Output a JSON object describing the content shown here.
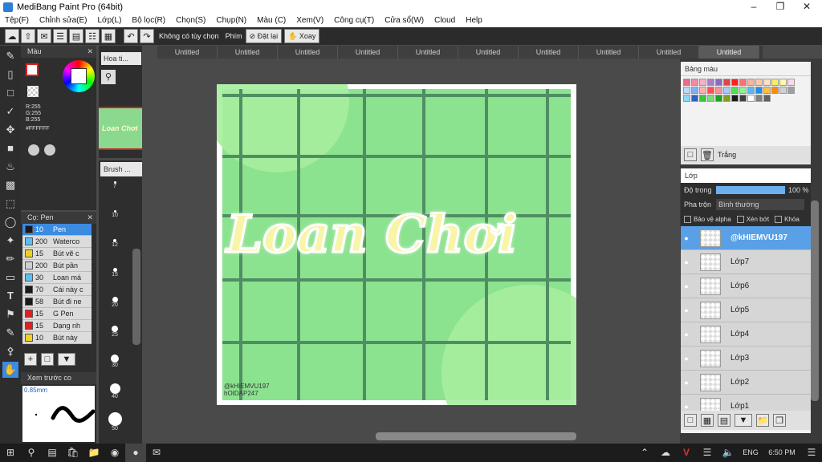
{
  "window": {
    "title": "MediBang Paint Pro (64bit)"
  },
  "menu": [
    "Tệp(F)",
    "Chỉnh sửa(E)",
    "Lớp(L)",
    "Bộ lọc(R)",
    "Chọn(S)",
    "Chụp(N)",
    "Màu (C)",
    "Xem(V)",
    "Công cụ(T)",
    "Cửa sổ(W)",
    "Cloud",
    "Help"
  ],
  "toolbar": {
    "selection_label": "Không có tùy chọn",
    "shortcut_label": "Phím",
    "reset_label": "Đặt lại",
    "rotate_label": "Xoay"
  },
  "tabs": [
    "Untitled",
    "Untitled",
    "Untitled",
    "Untitled",
    "Untitled",
    "Untitled",
    "Untitled",
    "Untitled",
    "Untitled",
    "Untitled"
  ],
  "active_tab_index": 9,
  "color_panel": {
    "title": "Màu",
    "r": "R:255",
    "g": "G:255",
    "b": "B:255",
    "hex": "#FFFFFF"
  },
  "brush_panel": {
    "title": "Cọ: Pen",
    "items": [
      {
        "size": "10",
        "name": "Pen",
        "color": "#1a1a1a",
        "selected": true
      },
      {
        "size": "200",
        "name": "Waterco",
        "color": "#5bc0f0"
      },
      {
        "size": "15",
        "name": "Bút vẽ c",
        "color": "#f0d020"
      },
      {
        "size": "200",
        "name": "Bút pần",
        "color": "#cfcfcf"
      },
      {
        "size": "30",
        "name": "Loan má",
        "color": "#5bc0f0"
      },
      {
        "size": "70",
        "name": "Cái này c",
        "color": "#1a1a1a"
      },
      {
        "size": "58",
        "name": "Bút đi ne",
        "color": "#1a1a1a"
      },
      {
        "size": "15",
        "name": "G Pen",
        "color": "#e02020"
      },
      {
        "size": "15",
        "name": "Dạng nh",
        "color": "#e02020"
      },
      {
        "size": "10",
        "name": "Bút này",
        "color": "#f0d020"
      }
    ]
  },
  "preview_panel": {
    "title": "Xem trước co",
    "size": "0.85mm"
  },
  "nav_panel": {
    "title": "Hoa ti..."
  },
  "brush_size_panel": {
    "title": "Brush ...",
    "sizes": [
      "7",
      "10",
      "12",
      "15",
      "20",
      "25",
      "30",
      "40",
      "50"
    ]
  },
  "canvas": {
    "title_text": "Loan Chơi",
    "watermark1": "@kHIEMVU197",
    "watermark2": "hOIDAP247"
  },
  "palette_panel": {
    "title": "Bảng màu",
    "current": "Trắng",
    "colors": [
      "#e86b8a",
      "#f08aa5",
      "#f5b0c4",
      "#b07cc6",
      "#8a6bc0",
      "#d84848",
      "#ff1f1f",
      "#ff7070",
      "#f8b4a0",
      "#ffc8a8",
      "#ffe0c8",
      "#f4ee6a",
      "#fff8a8",
      "#ffd8e8",
      "#b8d8ff",
      "#7ab0ff",
      "#ffb0b0",
      "#ff5050",
      "#ff9090",
      "#a8c8ff",
      "#50e050",
      "#90f090",
      "#5ab8f0",
      "#2090e0",
      "#ffc040",
      "#ff8c00",
      "#d0d0d0",
      "#a0a0a0",
      "#8cd8f0",
      "#3060c0",
      "#40c040",
      "#80d880",
      "#20a020",
      "#80a020",
      "#1a1a1a",
      "#404040",
      "#ffffff",
      "#808080",
      "#606060"
    ]
  },
  "layer_panel": {
    "title": "Lớp",
    "opacity_label": "Độ trong",
    "opacity_value": "100 %",
    "blend_label": "Pha trộn",
    "blend_value": "Bình thường",
    "protect_alpha": "Bảo vệ alpha",
    "clipping": "Xén bớt",
    "lock": "Khóa",
    "layers": [
      "@kHIEMVU197",
      "Lớp7",
      "Lớp6",
      "Lớp5",
      "Lớp4",
      "Lớp3",
      "Lớp2",
      "Lớp1"
    ]
  },
  "taskbar": {
    "time": "6:50 PM",
    "lang": "ENG"
  }
}
